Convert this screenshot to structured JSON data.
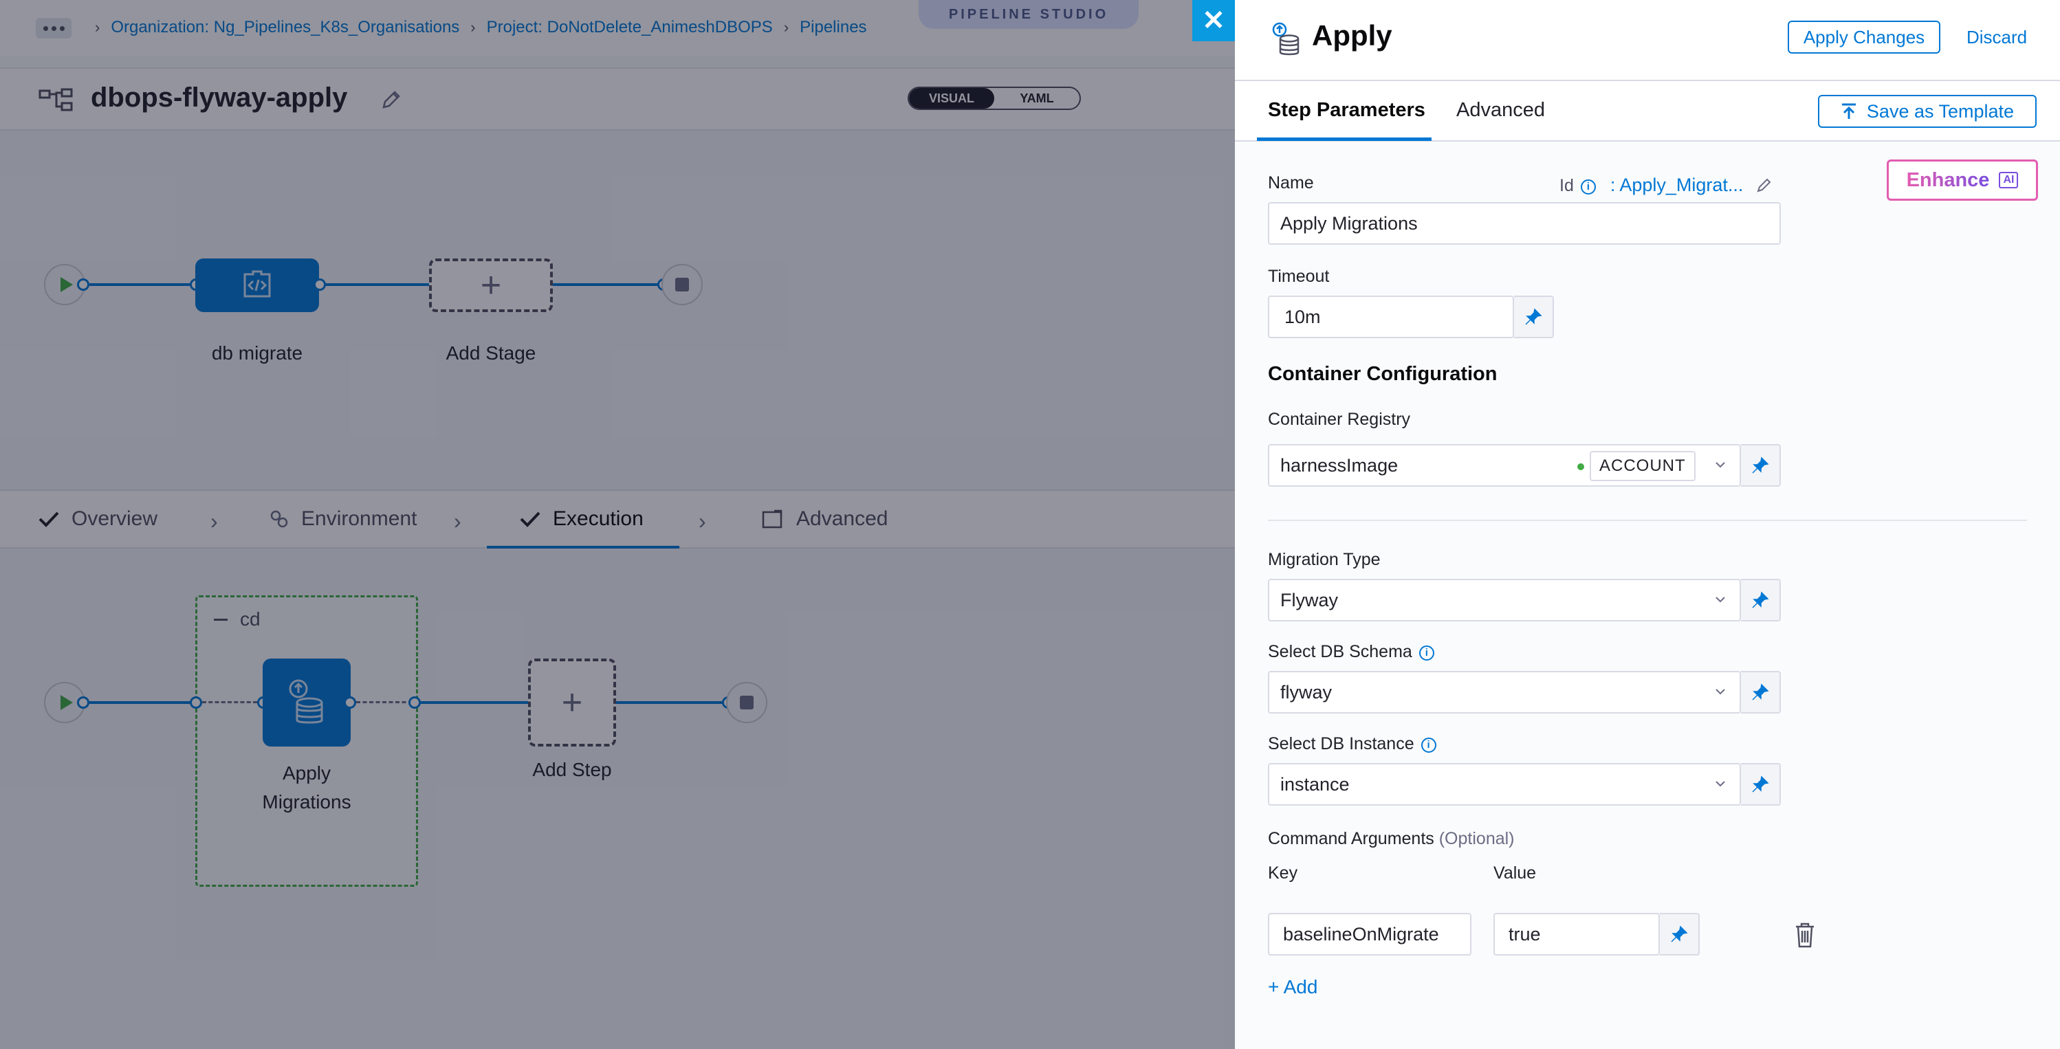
{
  "breadcrumbs": [
    "Organization: Ng_Pipelines_K8s_Organisations",
    "Project: DoNotDelete_AnimeshDBOPS",
    "Pipelines"
  ],
  "studio_badge": "PIPELINE STUDIO",
  "pipeline": {
    "name": "dbops-flyway-apply",
    "view_toggle": [
      "VISUAL",
      "YAML"
    ],
    "active_view": "VISUAL"
  },
  "stage_graph": {
    "stage_name": "db migrate",
    "add_stage": "Add Stage"
  },
  "stage_tabs": [
    {
      "label": "Overview",
      "icon": "check-icon"
    },
    {
      "label": "Environment",
      "icon": "environment-icon"
    },
    {
      "label": "Execution",
      "icon": "check-icon",
      "active": true
    },
    {
      "label": "Advanced",
      "icon": "advanced-icon"
    }
  ],
  "execution_graph": {
    "group": "cd",
    "step_name": "Apply Migrations",
    "add_step": "Add Step"
  },
  "drawer": {
    "title": "Apply",
    "apply_changes": "Apply Changes",
    "discard": "Discard",
    "tabs": [
      "Step Parameters",
      "Advanced"
    ],
    "active_tab": "Step Parameters",
    "save_as_template": "Save as Template",
    "enhance": "Enhance",
    "ai_tag": "AI",
    "name_label": "Name",
    "id_label": "Id",
    "id_value": ": Apply_Migrat...",
    "name_value": "Apply Migrations",
    "timeout_label": "Timeout",
    "timeout_value": "10m",
    "container_section": "Container Configuration",
    "registry_label": "Container Registry",
    "registry_value": "harnessImage",
    "registry_scope": "ACCOUNT",
    "migration_type_label": "Migration Type",
    "migration_type_value": "Flyway",
    "schema_label": "Select DB Schema",
    "schema_value": "flyway",
    "instance_label": "Select DB Instance",
    "instance_value": "instance",
    "cmd_args_label": "Command Arguments",
    "cmd_args_optional": "(Optional)",
    "key_header": "Key",
    "value_header": "Value",
    "arg_key": "baselineOnMigrate",
    "arg_value": "true",
    "add_label": "+ Add"
  },
  "colors": {
    "accent": "#0278d5",
    "stage_ok": "#42ab45",
    "close_tab": "#0a9ae0"
  }
}
